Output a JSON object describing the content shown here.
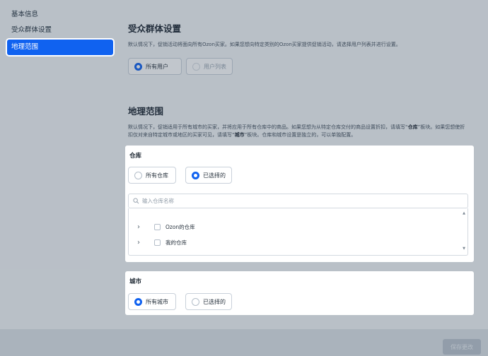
{
  "sidebar": {
    "items": [
      {
        "label": "基本信息"
      },
      {
        "label": "受众群体设置"
      },
      {
        "label": "地理范围"
      }
    ]
  },
  "audience": {
    "title": "受众群体设置",
    "description": "默认情况下，促销活动将面向所有Ozon买家。如果您想向特定类别的Ozon买家提供促销活动，请选择用户列表并进行设置。",
    "options": [
      "所有用户",
      "用户列表"
    ]
  },
  "geo": {
    "title": "地理范围",
    "description_part1": "默认情况下，促销适用于所有城市的买家，并将应用于所有仓库中的商品。如果您想为从特定仓库交付的商品设置折扣，请填写“",
    "description_bold1": "仓库",
    "description_part2": "”板块。如果您想使折扣仅对来自特定城市或地区的买家可见，请填写“",
    "description_bold2": "城市",
    "description_part3": "”板块。仓库和城市设置是独立的，可以单独配置。"
  },
  "warehouse": {
    "title": "仓库",
    "options": [
      "所有仓库",
      "已选择的"
    ],
    "search_placeholder": "输入仓库名称",
    "tree": [
      {
        "label": "Ozon的仓库"
      },
      {
        "label": "我的仓库"
      }
    ]
  },
  "city": {
    "title": "城市",
    "options": [
      "所有城市",
      "已选择的"
    ]
  },
  "footer": {
    "save_label": "保存更改"
  }
}
